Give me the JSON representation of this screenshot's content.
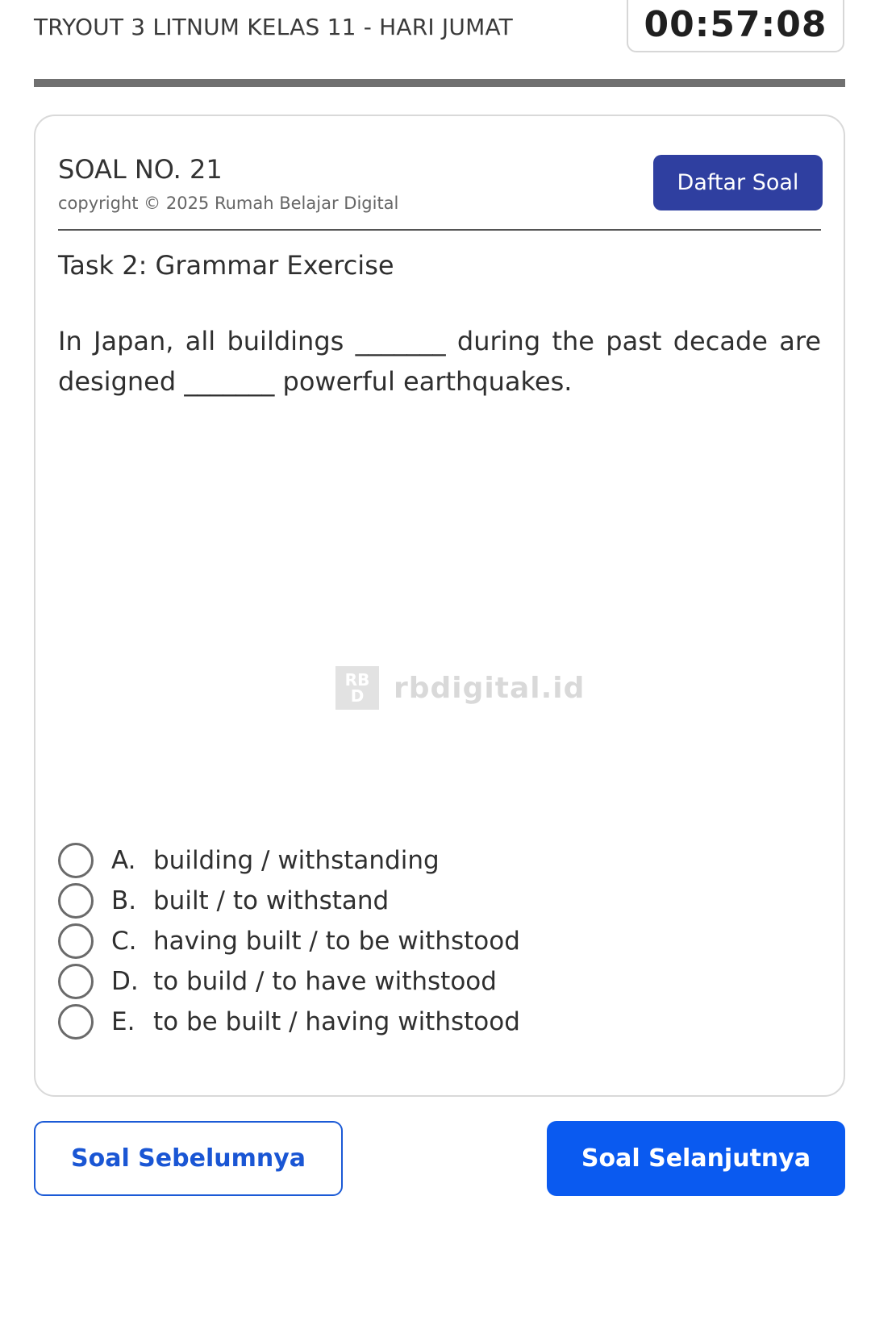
{
  "header": {
    "exam_title": "TRYOUT 3 LITNUM KELAS 11 - HARI JUMAT",
    "timer": "00:57:08"
  },
  "question": {
    "number_label": "SOAL NO. 21",
    "copyright": "copyright © 2025 Rumah Belajar Digital",
    "list_button": "Daftar Soal",
    "task_title": "Task 2: Grammar Exercise",
    "text": "In Japan, all buildings _______ during the past decade are designed _______ powerful earthquakes.",
    "watermark": {
      "logo_lines": [
        "RB",
        "D"
      ],
      "text": "rbdigital.id"
    },
    "options": [
      {
        "letter": "A.",
        "text": "building / withstanding"
      },
      {
        "letter": "B.",
        "text": "built / to withstand"
      },
      {
        "letter": "C.",
        "text": "having built / to be withstood"
      },
      {
        "letter": "D.",
        "text": "to build / to have withstood"
      },
      {
        "letter": "E.",
        "text": "to be built / having withstood"
      }
    ]
  },
  "navigation": {
    "prev_label": "Soal Sebelumnya",
    "next_label": "Soal Selanjutnya"
  },
  "colors": {
    "list_button_bg": "#2f3fa0",
    "next_button_bg": "#0a5af0",
    "prev_button_text": "#1a56d4"
  }
}
